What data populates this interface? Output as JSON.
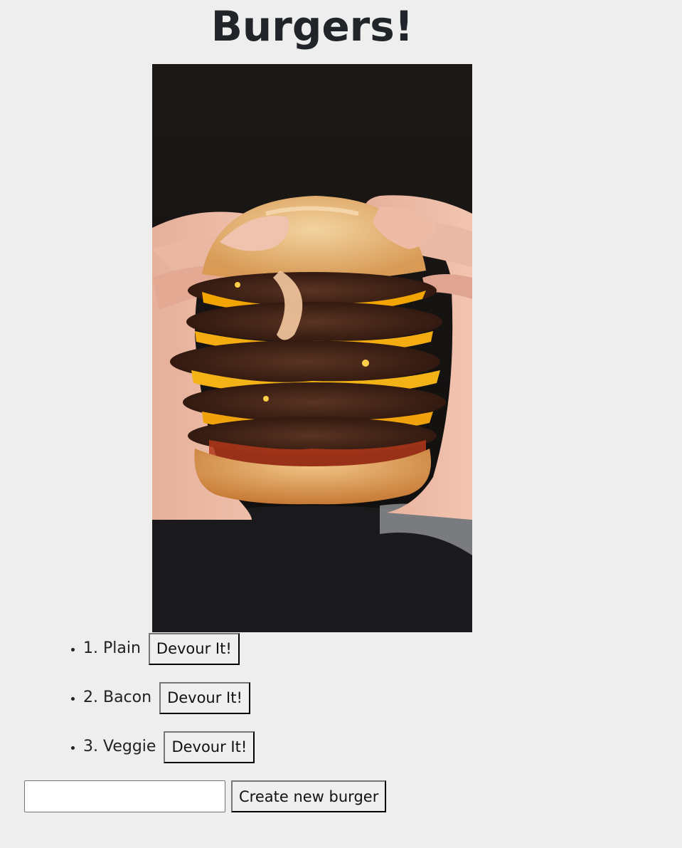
{
  "page": {
    "title": "Burgers!"
  },
  "hero_image": {
    "alt": "Hands holding a stacked cheeseburger"
  },
  "burgers": [
    {
      "label": "1. Plain",
      "button": "Devour It!"
    },
    {
      "label": "2. Bacon",
      "button": "Devour It!"
    },
    {
      "label": "3. Veggie",
      "button": "Devour It!"
    }
  ],
  "form": {
    "input_value": "",
    "input_placeholder": "",
    "submit_label": "Create new burger"
  }
}
